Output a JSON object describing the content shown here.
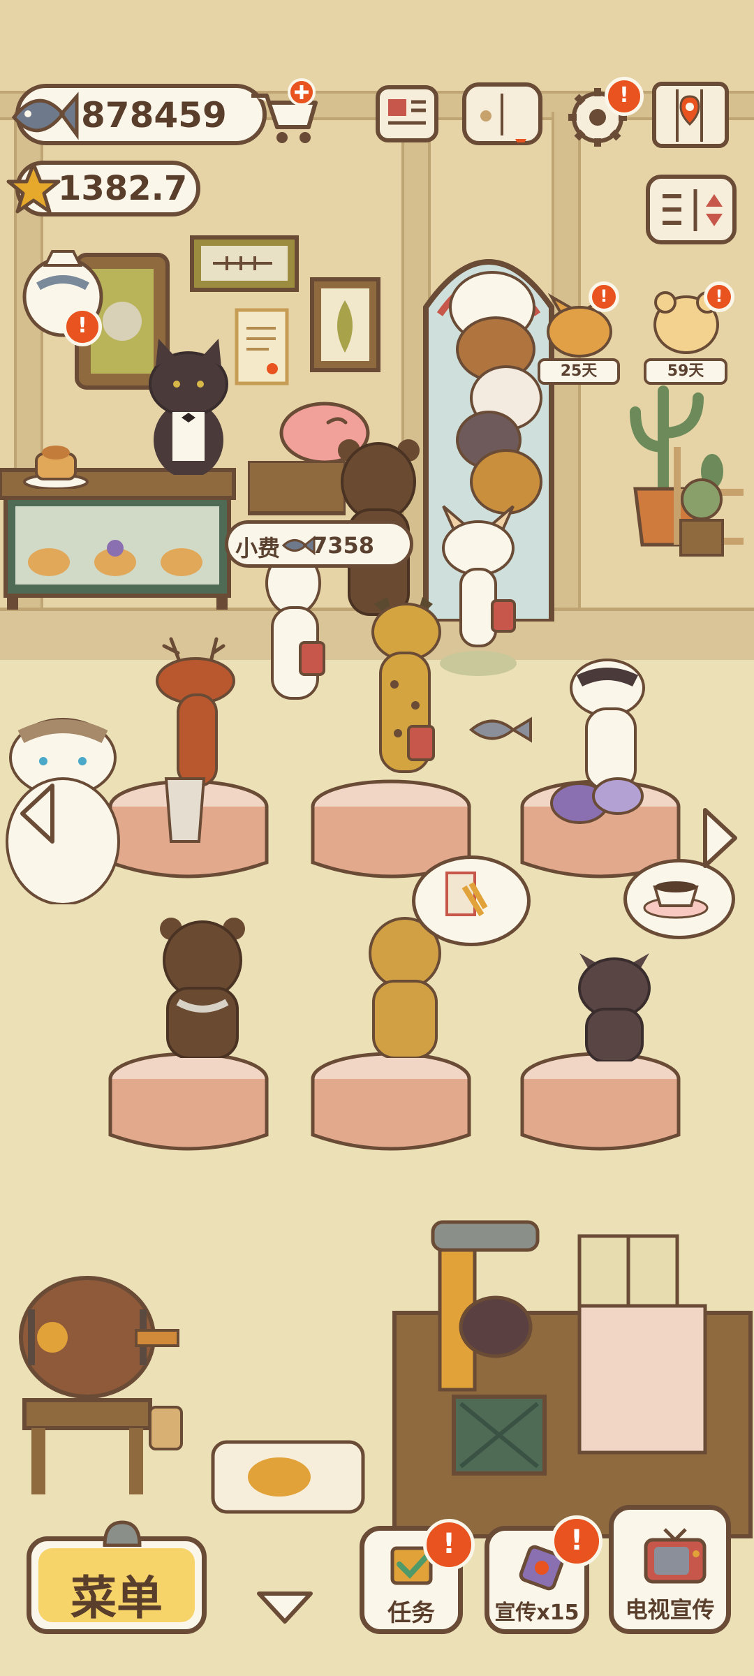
{
  "hud": {
    "fish_currency": "878459",
    "star_rating": "1382.7",
    "tip": {
      "label": "小费",
      "amount": "7358"
    }
  },
  "guests": [
    {
      "name": "fox-guest",
      "days": "25天"
    },
    {
      "name": "hamster-guest",
      "days": "59天"
    }
  ],
  "bottom_bar": {
    "menu_label": "菜单",
    "tasks_label": "任务",
    "promo_label": "宣传x15",
    "tv_promo_label": "电视宣传"
  },
  "icons": {
    "fish": "fish-icon",
    "star": "star-icon",
    "cart": "shop-cart-icon",
    "newspaper": "newspaper-icon",
    "book": "paw-book-icon",
    "settings": "gear-icon",
    "map": "map-icon",
    "sort": "sort-icon",
    "alert": "exclamation-badge-icon",
    "tv": "tv-icon"
  },
  "colors": {
    "outline": "#6a4b36",
    "alert": "#e8531f",
    "tablecloth": "#e3a98d",
    "menu_button": "#f6d469"
  }
}
